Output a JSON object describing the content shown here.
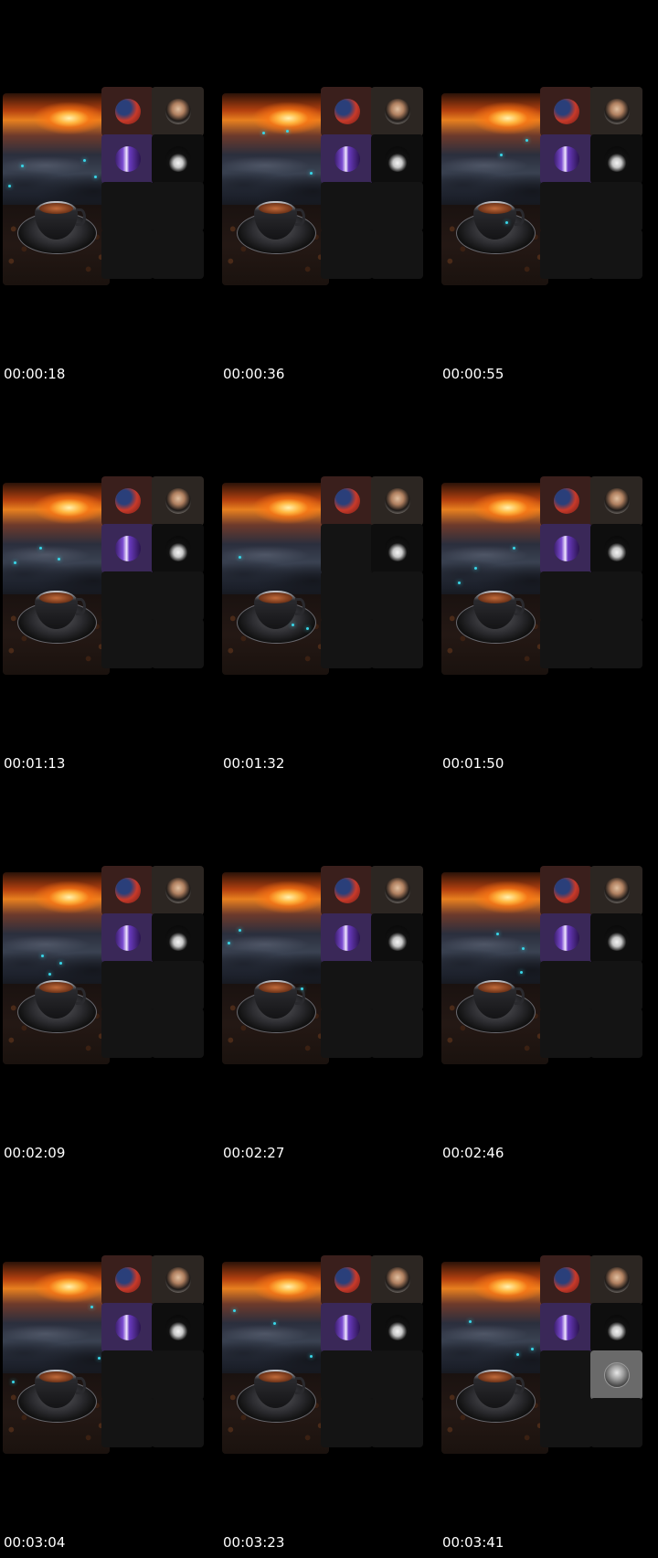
{
  "frames": [
    {
      "timestamp": "00:00:18",
      "tiles": [
        "redhead",
        "man",
        "purple",
        "dark",
        "empty",
        "empty",
        "empty",
        "empty"
      ]
    },
    {
      "timestamp": "00:00:36",
      "tiles": [
        "redhead",
        "man",
        "purple",
        "dark",
        "empty",
        "empty",
        "empty",
        "empty"
      ]
    },
    {
      "timestamp": "00:00:55",
      "tiles": [
        "redhead",
        "man",
        "purple",
        "dark",
        "empty",
        "empty",
        "empty",
        "empty"
      ]
    },
    {
      "timestamp": "00:01:13",
      "tiles": [
        "redhead",
        "man",
        "purple",
        "dark",
        "empty",
        "empty",
        "empty",
        "empty"
      ]
    },
    {
      "timestamp": "00:01:32",
      "tiles": [
        "redhead",
        "man",
        "empty",
        "dark",
        "empty",
        "empty",
        "empty",
        "empty"
      ]
    },
    {
      "timestamp": "00:01:50",
      "tiles": [
        "redhead",
        "man",
        "purple",
        "dark",
        "empty",
        "empty",
        "empty",
        "empty"
      ]
    },
    {
      "timestamp": "00:02:09",
      "tiles": [
        "redhead",
        "man",
        "purple",
        "dark",
        "empty",
        "empty",
        "empty",
        "empty"
      ]
    },
    {
      "timestamp": "00:02:27",
      "tiles": [
        "redhead",
        "man",
        "purple",
        "dark",
        "empty",
        "empty",
        "empty",
        "empty"
      ]
    },
    {
      "timestamp": "00:02:46",
      "tiles": [
        "redhead",
        "man",
        "purple",
        "dark",
        "empty",
        "empty",
        "empty",
        "empty"
      ]
    },
    {
      "timestamp": "00:03:04",
      "tiles": [
        "redhead",
        "man",
        "purple",
        "dark",
        "empty",
        "empty",
        "empty",
        "empty"
      ]
    },
    {
      "timestamp": "00:03:23",
      "tiles": [
        "redhead",
        "man",
        "purple",
        "dark",
        "empty",
        "empty",
        "empty",
        "empty"
      ]
    },
    {
      "timestamp": "00:03:41",
      "tiles": [
        "redhead",
        "man",
        "purple",
        "dark",
        "empty",
        "grey",
        "empty",
        "empty"
      ]
    }
  ],
  "colors": {
    "background": "#000000",
    "timestamp_text": "#ffffff",
    "particle": "#39d6e8",
    "sun": "#e7801f"
  },
  "icons": {
    "hero": "coffee-cup-sunset-image",
    "redhead": "avatar-red-hair",
    "man": "avatar-man",
    "purple": "avatar-purple-light",
    "dark": "avatar-dark-figure",
    "grey": "avatar-grey-portrait"
  }
}
